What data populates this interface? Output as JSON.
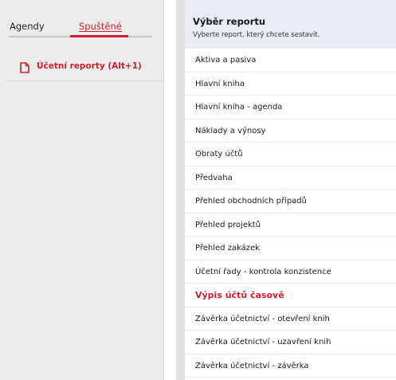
{
  "tabs": {
    "agendy": "Agendy",
    "spustene": "Spuštěné"
  },
  "running": {
    "items": [
      {
        "label": "Účetní reporty (Alt+1)",
        "icon": "document-icon"
      }
    ]
  },
  "report_panel": {
    "title": "Výběr reportu",
    "subtitle": "Vyberte report, který chcete sestavit.",
    "items": [
      "Aktiva a pasiva",
      "Hlavní kniha",
      "Hlavní kniha - agenda",
      "Náklady a výnosy",
      "Obraty účtů",
      "Předvaha",
      "Přehled obchodních případů",
      "Přehled projektů",
      "Přehled zakázek",
      "Účetní řady  - kontrola konzistence",
      "Výpis účtů časově",
      "Závěrka účetnictví - otevření knih",
      "Závěrka účetnictví - uzavření knih",
      "Závěrka účetnictví - závěrka"
    ],
    "selected": "Výpis účtů časově"
  },
  "colors": {
    "accent": "#cc1f2d",
    "header_bg": "#e8edf3",
    "left_bg": "#ececec"
  }
}
